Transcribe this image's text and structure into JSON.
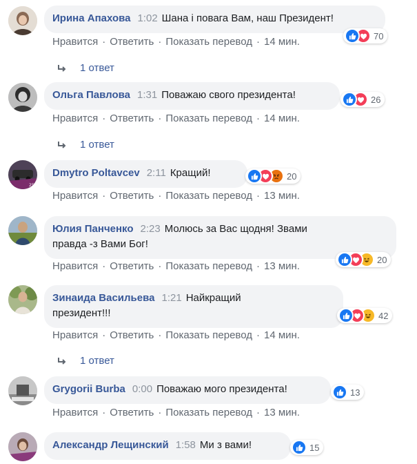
{
  "comments": [
    {
      "author": "Ирина Апахова",
      "duration": "1:02",
      "text_lines": [
        "Шана і повага Вам, наш Президент!"
      ],
      "reactions": [
        "like",
        "love"
      ],
      "reaction_count": "70",
      "like_label": "Нравится",
      "reply_label": "Ответить",
      "translate_label": "Показать перевод",
      "time": "14 мин.",
      "replies": "1 ответ"
    },
    {
      "author": "Ольга Павлова",
      "duration": "1:31",
      "text_lines": [
        "Поважаю свого президента!"
      ],
      "reactions": [
        "like",
        "love"
      ],
      "reaction_count": "26",
      "like_label": "Нравится",
      "reply_label": "Ответить",
      "translate_label": "Показать перевод",
      "time": "14 мин.",
      "replies": "1 ответ"
    },
    {
      "author": "Dmytro Poltavcev",
      "duration": "2:11",
      "text_lines": [
        "Кращий!"
      ],
      "reactions": [
        "like",
        "love",
        "angry"
      ],
      "reaction_count": "20",
      "like_label": "Нравится",
      "reply_label": "Ответить",
      "translate_label": "Показать перевод",
      "time": "13 мин."
    },
    {
      "author": "Юлия Панченко",
      "duration": "2:23",
      "text_lines": [
        "Молюсь за Вас щодня! Звами",
        "правда -з Вами Бог!"
      ],
      "reactions": [
        "like",
        "love",
        "haha"
      ],
      "reaction_count": "20",
      "like_label": "Нравится",
      "reply_label": "Ответить",
      "translate_label": "Показать перевод",
      "time": "13 мин."
    },
    {
      "author": "Зинаида Васильева",
      "duration": "1:21",
      "text_lines": [
        "Найкращий",
        "президент!!!"
      ],
      "reactions": [
        "like",
        "love",
        "haha"
      ],
      "reaction_count": "42",
      "like_label": "Нравится",
      "reply_label": "Ответить",
      "translate_label": "Показать перевод",
      "time": "14 мин.",
      "replies": "1 ответ"
    },
    {
      "author": "Grygorii Burba",
      "duration": "0:00",
      "text_lines": [
        "Поважаю мого президента!"
      ],
      "reactions": [
        "like"
      ],
      "reaction_count": "13",
      "like_label": "Нравится",
      "reply_label": "Ответить",
      "translate_label": "Показать перевод",
      "time": "13 мин."
    },
    {
      "author": "Александр Лещинский",
      "duration": "1:58",
      "text_lines": [
        "Ми з вами!"
      ],
      "reactions": [
        "like"
      ],
      "reaction_count": "15"
    }
  ],
  "colors": {
    "author": "#385898",
    "bubble_bg": "#f2f3f5",
    "meta": "#606770",
    "like": "#1877f2",
    "love": "#f33e58",
    "haha": "#f7b928",
    "angry": "#e9710f"
  },
  "icons": {
    "like": "thumbs-up-icon",
    "love": "heart-icon",
    "haha": "laughing-face-icon",
    "angry": "angry-face-icon",
    "reply": "reply-arrow-icon"
  }
}
